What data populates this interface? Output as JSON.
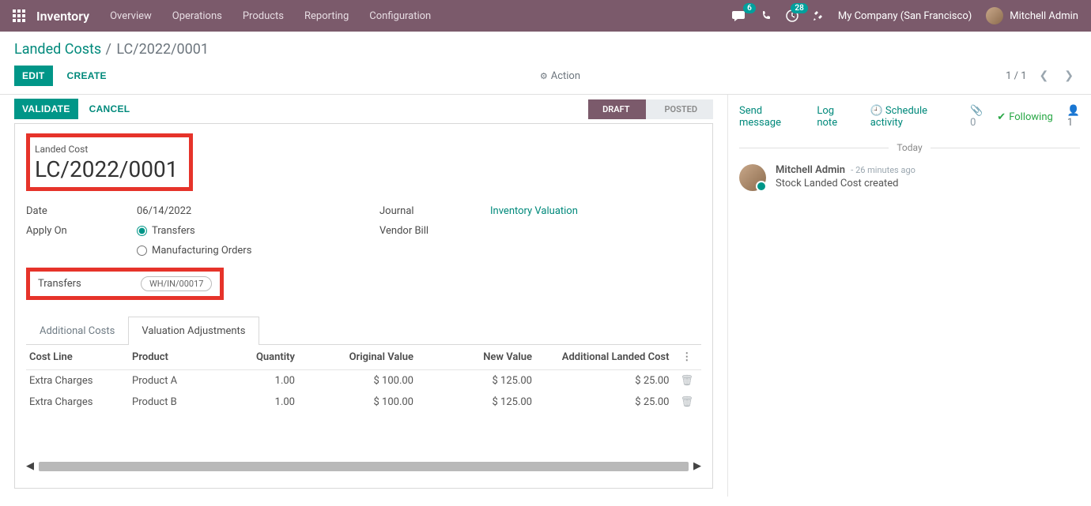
{
  "nav": {
    "brand": "Inventory",
    "items": [
      "Overview",
      "Operations",
      "Products",
      "Reporting",
      "Configuration"
    ],
    "badge_messages": "6",
    "badge_activities": "28",
    "company": "My Company (San Francisco)",
    "user": "Mitchell Admin"
  },
  "breadcrumb": {
    "parent": "Landed Costs",
    "current": "LC/2022/0001"
  },
  "controls": {
    "edit": "Edit",
    "create": "Create",
    "action": "Action",
    "pager": "1 / 1"
  },
  "status": {
    "validate": "Validate",
    "cancel": "Cancel",
    "stages": [
      "Draft",
      "Posted"
    ]
  },
  "form": {
    "title_label": "Landed Cost",
    "title": "LC/2022/0001",
    "date_label": "Date",
    "date": "06/14/2022",
    "apply_label": "Apply On",
    "apply_opt1": "Transfers",
    "apply_opt2": "Manufacturing Orders",
    "transfers_label": "Transfers",
    "transfers_tag": "WH/IN/00017",
    "journal_label": "Journal",
    "journal": "Inventory Valuation",
    "vendor_bill_label": "Vendor Bill"
  },
  "tabs": {
    "t1": "Additional Costs",
    "t2": "Valuation Adjustments"
  },
  "table": {
    "headers": {
      "cost_line": "Cost Line",
      "product": "Product",
      "quantity": "Quantity",
      "original_value": "Original Value",
      "new_value": "New Value",
      "additional": "Additional Landed Cost"
    },
    "rows": [
      {
        "cost_line": "Extra Charges",
        "product": "Product A",
        "quantity": "1.00",
        "original_value": "$ 100.00",
        "new_value": "$ 125.00",
        "additional": "$ 25.00"
      },
      {
        "cost_line": "Extra Charges",
        "product": "Product B",
        "quantity": "1.00",
        "original_value": "$ 100.00",
        "new_value": "$ 125.00",
        "additional": "$ 25.00"
      }
    ]
  },
  "chatter": {
    "send": "Send message",
    "log": "Log note",
    "schedule": "Schedule activity",
    "attach_count": "0",
    "following": "Following",
    "followers": "1",
    "today": "Today",
    "msg_author": "Mitchell Admin",
    "msg_time": "- 26 minutes ago",
    "msg_body": "Stock Landed Cost created"
  }
}
